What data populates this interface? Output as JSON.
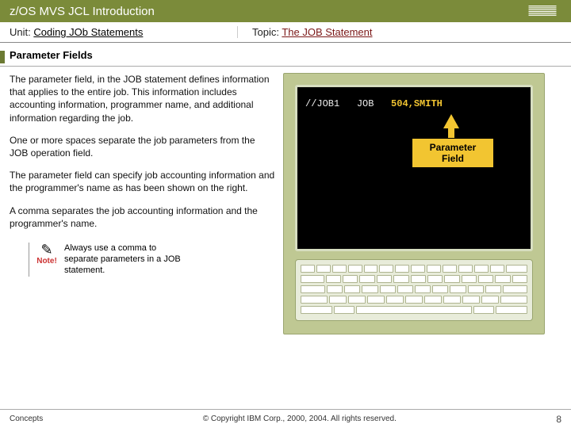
{
  "titlebar": {
    "title": "z/OS MVS JCL Introduction"
  },
  "unitrow": {
    "unit_label": "Unit: ",
    "unit_value": "Coding JOb Statements",
    "topic_label": "Topic: ",
    "topic_value": "The JOB Statement"
  },
  "section": {
    "heading": "Parameter Fields"
  },
  "paragraphs": {
    "p1": "The parameter field, in the JOB statement defines information that applies to the entire job. This information includes accounting information, programmer name, and additional information regarding the job.",
    "p2": "One or more spaces separate the job parameters from the JOB operation field.",
    "p3": "The parameter field can specify job accounting information and the programmer's name as has been shown on the right.",
    "p4": "A comma separates the job accounting information and the programmer's name."
  },
  "note": {
    "label": "Note!",
    "text": "Always use a comma to separate parameters in a JOB statement."
  },
  "terminal": {
    "jobname": "//JOB1",
    "operation": "JOB",
    "parameters": "504,SMITH",
    "callout_l1": "Parameter",
    "callout_l2": "Field"
  },
  "footer": {
    "left": "Concepts",
    "copyright": "© Copyright IBM Corp., 2000, 2004. All rights reserved.",
    "page": "8"
  }
}
